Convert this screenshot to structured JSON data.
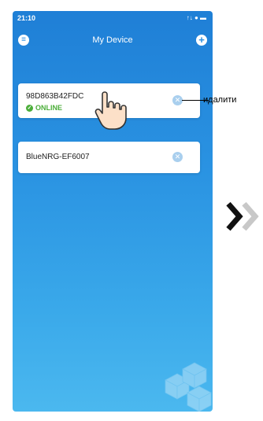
{
  "status_bar": {
    "time": "21:10",
    "icons": "↑↓ ● ▬"
  },
  "header": {
    "title": "My Device",
    "menu_icon": "menu-icon",
    "add_icon": "add-icon"
  },
  "devices": [
    {
      "name": "98D863B42FDC",
      "status": "ONLINE"
    },
    {
      "name": "BlueNRG-EF6007",
      "status": ""
    }
  ],
  "annotation": {
    "label": "идалити"
  },
  "colors": {
    "accent": "#2a8ee0",
    "online": "#4cae3a",
    "remove": "#a9cfee"
  }
}
